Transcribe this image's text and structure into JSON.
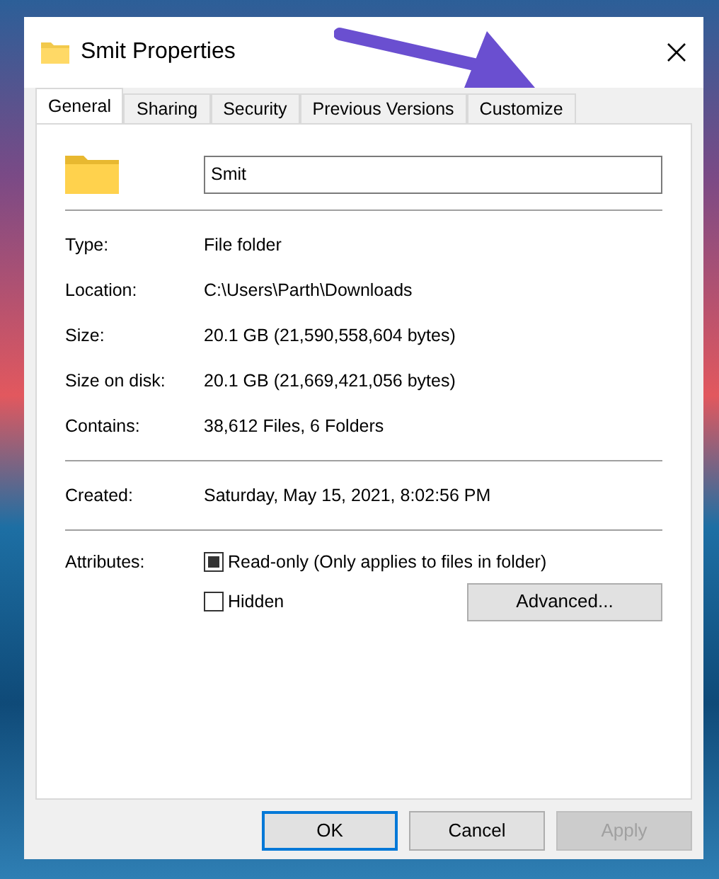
{
  "window": {
    "title": "Smit Properties"
  },
  "tabs": [
    {
      "label": "General",
      "selected": true
    },
    {
      "label": "Sharing",
      "selected": false
    },
    {
      "label": "Security",
      "selected": false
    },
    {
      "label": "Previous Versions",
      "selected": false
    },
    {
      "label": "Customize",
      "selected": false
    }
  ],
  "name_field": {
    "value": "Smit"
  },
  "sections": [
    [
      {
        "label": "Type:",
        "value": "File folder"
      },
      {
        "label": "Location:",
        "value": "C:\\Users\\Parth\\Downloads"
      },
      {
        "label": "Size:",
        "value": "20.1 GB (21,590,558,604 bytes)"
      },
      {
        "label": "Size on disk:",
        "value": "20.1 GB (21,669,421,056 bytes)"
      },
      {
        "label": "Contains:",
        "value": "38,612 Files, 6 Folders"
      }
    ],
    [
      {
        "label": "Created:",
        "value": "Saturday, May 15, 2021, 8:02:56 PM"
      }
    ]
  ],
  "attributes": {
    "label": "Attributes:",
    "options": [
      {
        "label": "Read-only (Only applies to files in folder)",
        "mixed": true
      },
      {
        "label": "Hidden",
        "mixed": false
      }
    ],
    "advanced_button": "Advanced..."
  },
  "buttons": [
    {
      "label": "OK",
      "default": true,
      "disabled": false
    },
    {
      "label": "Cancel",
      "default": false,
      "disabled": false
    },
    {
      "label": "Apply",
      "default": false,
      "disabled": true
    }
  ]
}
